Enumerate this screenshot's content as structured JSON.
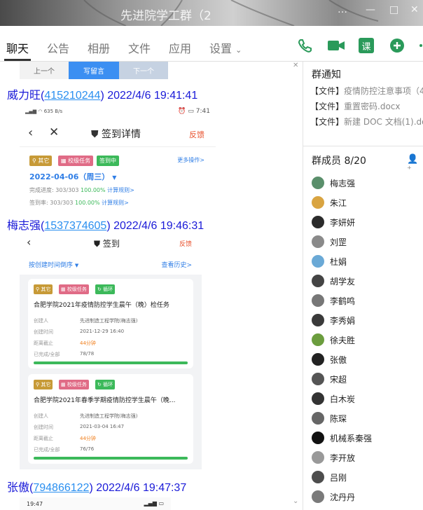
{
  "window": {
    "title": "先进院学工群（2",
    "controls": [
      "…",
      "—",
      "□",
      "✕"
    ]
  },
  "tabs": [
    {
      "label": "聊天",
      "active": true
    },
    {
      "label": "公告",
      "active": false
    },
    {
      "label": "相册",
      "active": false
    },
    {
      "label": "文件",
      "active": false
    },
    {
      "label": "应用",
      "active": false
    },
    {
      "label": "设置",
      "active": false
    }
  ],
  "toolbar": {
    "course_label": "课",
    "icons": [
      "phone-icon",
      "video-icon",
      "course-icon",
      "add-icon",
      "more-icon"
    ]
  },
  "top_partial": {
    "prev": "上一个",
    "write": "写留言",
    "next": "下一个"
  },
  "messages": [
    {
      "name": "威力旺",
      "qq": "415210244",
      "time": "2022/4/6 19:41:41"
    },
    {
      "name": "梅志强",
      "qq": "1537374605",
      "time": "2022/4/6 19:46:31"
    },
    {
      "name": "张傲",
      "qq": "794866122",
      "time": "2022/4/6 19:47:37"
    }
  ],
  "shot1": {
    "status_left": "635 B/s",
    "status_time": "7:41",
    "title": "签到详情",
    "feedback": "反馈",
    "tags": [
      "其它",
      "校级任务",
      "签到中"
    ],
    "more": "更多操作>",
    "date": "2022-04-06（周三）",
    "progress_label": "完成进度:",
    "progress_count": "303/303",
    "progress_pct": "100.00%",
    "progress_rule": "计算规则>",
    "rate_label": "签到率:",
    "rate_count": "303/303",
    "rate_pct": "100.00%",
    "rate_rule": "计算规则>"
  },
  "shot2": {
    "title": "签到",
    "feedback": "反馈",
    "sort": "按创建时间倒序",
    "history": "查看历史>",
    "cards": [
      {
        "tags": [
          "其它",
          "校级任务",
          "循环"
        ],
        "name": "合肥学院2021年疫情防控学生晨午（晚）检任务",
        "creator_label": "创建人",
        "creator": "先进制造工程学院(梅志强)",
        "created_label": "创建时间",
        "created": "2021-12-29 16:40",
        "deadline_label": "距离截止",
        "deadline": "44分钟",
        "done_label": "已完成/全部",
        "done": "78/78",
        "progress": 1.0
      },
      {
        "tags": [
          "其它",
          "校级任务",
          "循环"
        ],
        "name": "合肥学院2021年春季学期疫情防控学生晨午（晚...",
        "creator_label": "创建人",
        "creator": "先进制造工程学院(梅志强)",
        "created_label": "创建时间",
        "created": "2021-03-04 16:47",
        "deadline_label": "距离截止",
        "deadline": "44分钟",
        "done_label": "已完成/全部",
        "done": "76/76",
        "progress": 1.0
      }
    ]
  },
  "shot3": {
    "status_time": "19:47"
  },
  "sidebar": {
    "notice_title": "群通知",
    "notices": [
      {
        "tag": "【文件】",
        "name": "疫情防控注意事项（4."
      },
      {
        "tag": "【文件】",
        "name": "重置密码.docx"
      },
      {
        "tag": "【文件】",
        "name": "新建 DOC 文档(1).doc"
      }
    ],
    "members_title": "群成员 8/20",
    "members": [
      "梅志强",
      "朱江",
      "李妍妍",
      "刘罡",
      "杜娟",
      "胡学友",
      "李鹤鸣",
      "李秀娟",
      "徐夫胜",
      "张傲",
      "宋超",
      "白木炭",
      "陈琛",
      "机械系秦强",
      "李开放",
      "吕刚",
      "沈丹丹"
    ]
  },
  "colors": {
    "link": "#2a8ff0",
    "sender": "#1a1ad8",
    "green": "#3cb95a",
    "blue": "#2f7ee6",
    "orange": "#f07d19"
  }
}
